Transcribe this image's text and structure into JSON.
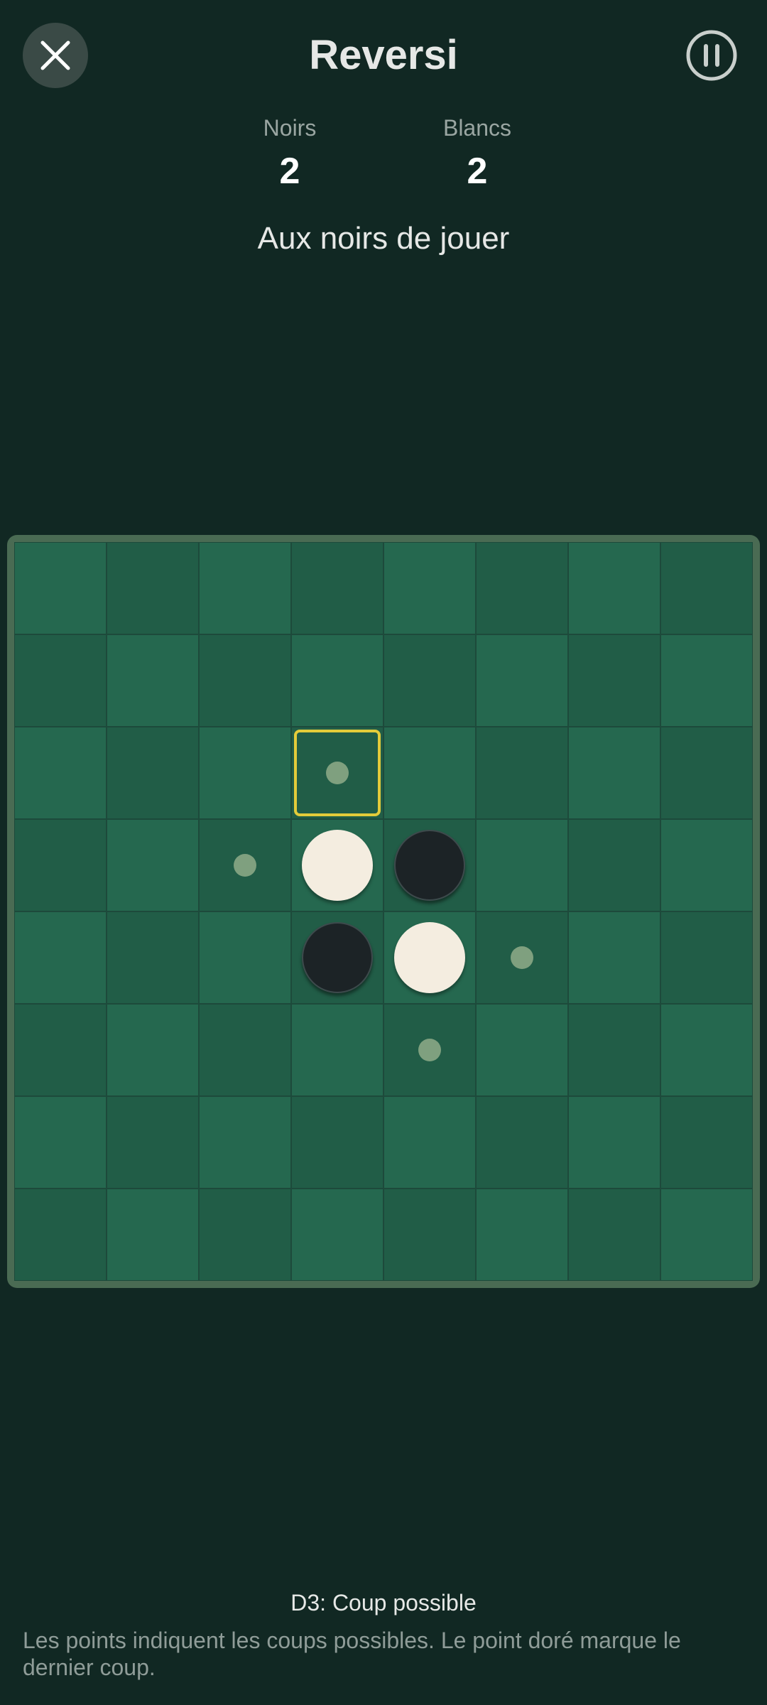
{
  "header": {
    "title": "Reversi",
    "close_icon": "close-icon",
    "pause_icon": "pause-icon"
  },
  "scores": {
    "black": {
      "label": "Noirs",
      "value": "2"
    },
    "white": {
      "label": "Blancs",
      "value": "2"
    }
  },
  "turn_text": "Aux noirs de jouer",
  "board": {
    "size": 8,
    "colors": {
      "light": "#25684f",
      "dark": "#215d47",
      "highlight": "#e3cb3a",
      "hint": "#7fa07f"
    },
    "last_move": "D3",
    "pieces": [
      {
        "cell": "D4",
        "color": "white"
      },
      {
        "cell": "E4",
        "color": "black"
      },
      {
        "cell": "D5",
        "color": "black"
      },
      {
        "cell": "E5",
        "color": "white"
      }
    ],
    "hints": [
      "D3",
      "C4",
      "F5",
      "E6"
    ]
  },
  "status": "D3: Coup possible",
  "help": "Les points indiquent les coups possibles. Le point doré marque le dernier coup."
}
